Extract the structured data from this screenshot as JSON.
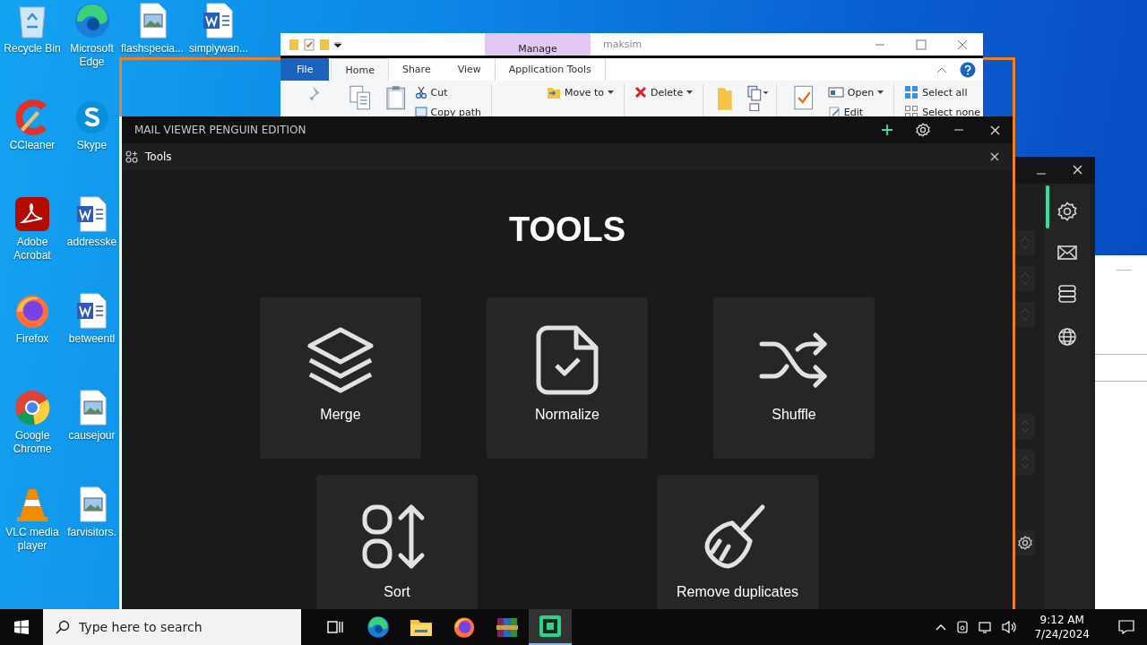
{
  "desktop_icons": [
    {
      "kind": "recycle",
      "label": "Recycle Bin"
    },
    {
      "kind": "ccleaner",
      "label": "CCleaner"
    },
    {
      "kind": "acrobat",
      "label": "Adobe Acrobat"
    },
    {
      "kind": "firefox",
      "label": "Firefox"
    },
    {
      "kind": "chrome",
      "label": "Google Chrome"
    },
    {
      "kind": "vlc",
      "label": "VLC media player"
    },
    {
      "kind": "edge",
      "label": "Microsoft Edge"
    },
    {
      "kind": "skype",
      "label": "Skype"
    },
    {
      "kind": "word",
      "label": "addresske"
    },
    {
      "kind": "word",
      "label": "betweentl"
    },
    {
      "kind": "image",
      "label": "causejour"
    },
    {
      "kind": "image",
      "label": "farvisitors."
    },
    {
      "kind": "image",
      "label": "flashspecia..."
    },
    {
      "kind": "word",
      "label": "simplywan..."
    }
  ],
  "explorer": {
    "context_tab": "Manage",
    "title": "maksim",
    "ribbon_tabs": [
      {
        "label": "File",
        "selected": false
      },
      {
        "label": "Home",
        "selected": true
      },
      {
        "label": "Share",
        "selected": false
      },
      {
        "label": "View",
        "selected": false
      },
      {
        "label": "Application Tools",
        "selected": false
      }
    ],
    "commands": [
      {
        "kind": "cut",
        "label": "Cut"
      },
      {
        "kind": "copy-path",
        "label": "Copy path"
      },
      {
        "kind": "move",
        "label": "Move to"
      },
      {
        "kind": "delete",
        "label": "Delete"
      },
      {
        "kind": "open",
        "label": "Open"
      },
      {
        "kind": "edit",
        "label": "Edit"
      },
      {
        "kind": "select-all",
        "label": "Select all"
      },
      {
        "kind": "select-none",
        "label": "Select none"
      }
    ]
  },
  "mail_viewer": {
    "title": "MAIL VIEWER PENGUIN EDITION",
    "tab": "Tools",
    "heading": "TOOLS",
    "tools": [
      {
        "kind": "merge",
        "label": "Merge"
      },
      {
        "kind": "normalize",
        "label": "Normalize"
      },
      {
        "kind": "shuffle",
        "label": "Shuffle"
      },
      {
        "kind": "sort",
        "label": "Sort"
      },
      {
        "kind": "clean",
        "label": "Remove duplicates"
      }
    ]
  },
  "side_window": {
    "nav": [
      {
        "kind": "settings",
        "selected": true
      },
      {
        "kind": "mail",
        "selected": false
      },
      {
        "kind": "database",
        "selected": false
      },
      {
        "kind": "globe",
        "selected": false
      }
    ]
  },
  "taskbar": {
    "search": {
      "placeholder": "Type here to search"
    },
    "apps": [
      {
        "kind": "task-view",
        "selected": false
      },
      {
        "kind": "edge",
        "selected": false
      },
      {
        "kind": "folder",
        "selected": false
      },
      {
        "kind": "firefox",
        "selected": false
      },
      {
        "kind": "archive",
        "selected": false
      },
      {
        "kind": "app",
        "selected": true
      }
    ],
    "time": "9:12 AM",
    "date": "7/24/2024"
  }
}
